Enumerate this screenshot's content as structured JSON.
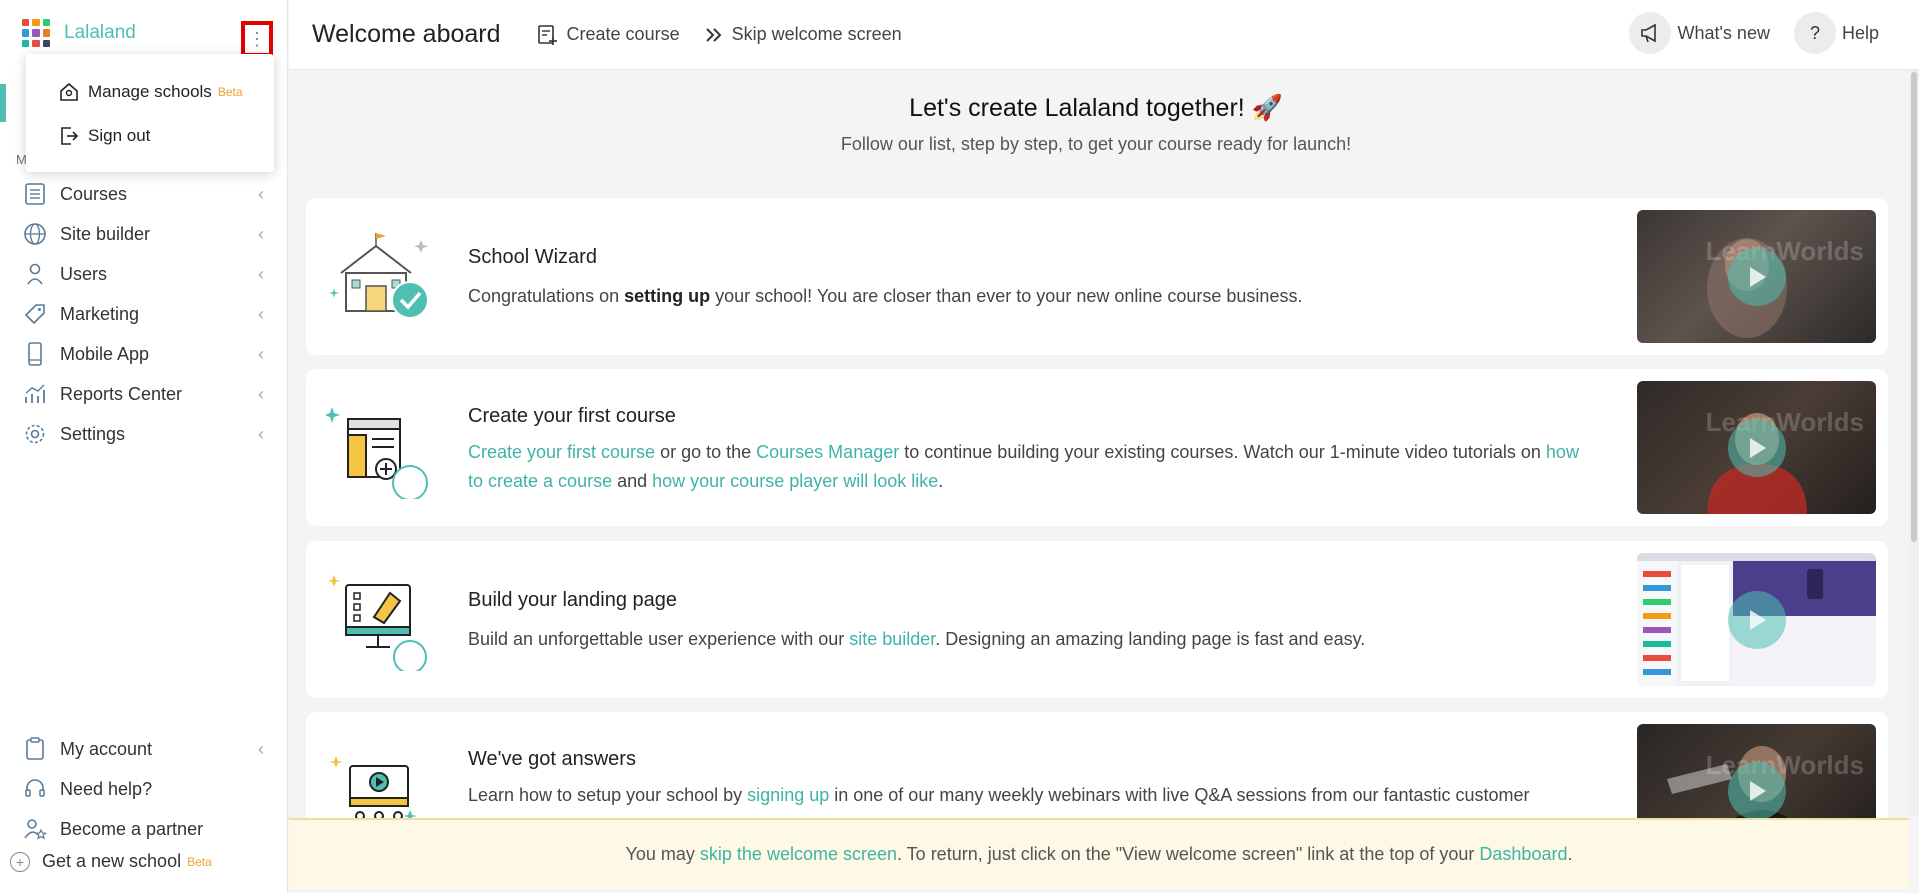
{
  "sidebar": {
    "brand_name": "Lalaland",
    "kebab_glyph": "⋮",
    "section_letter": "M",
    "items": [
      {
        "label": "Courses",
        "icon": "courses-icon"
      },
      {
        "label": "Site builder",
        "icon": "globe-icon"
      },
      {
        "label": "Users",
        "icon": "user-icon"
      },
      {
        "label": "Marketing",
        "icon": "tag-icon"
      },
      {
        "label": "Mobile App",
        "icon": "mobile-icon"
      },
      {
        "label": "Reports Center",
        "icon": "chart-icon"
      },
      {
        "label": "Settings",
        "icon": "gear-icon"
      }
    ],
    "bottom_items": [
      {
        "label": "My account",
        "icon": "clipboard-icon"
      },
      {
        "label": "Need help?",
        "icon": "headset-icon"
      },
      {
        "label": "Become a partner",
        "icon": "partner-icon"
      }
    ],
    "new_school_label": "Get a new school",
    "new_school_badge": "Beta"
  },
  "dropdown": {
    "manage_label": "Manage schools",
    "manage_badge": "Beta",
    "signout_label": "Sign out"
  },
  "topbar": {
    "title": "Welcome aboard",
    "create_course": "Create course",
    "skip_welcome": "Skip welcome screen",
    "whats_new": "What's new",
    "help": "Help"
  },
  "hero": {
    "title": "Let's create Lalaland together! 🚀",
    "subtitle": "Follow our list, step by step, to get your course ready for launch!"
  },
  "cards": [
    {
      "title": "School Wizard",
      "body_pre": "Congratulations on ",
      "body_bold": "setting up",
      "body_post": " your school! You are closer than ever to your new online course business."
    },
    {
      "title": "Create your first course",
      "link1": "Create your first course",
      "text1": " or go to the ",
      "link2": "Courses Manager",
      "text2": " to continue building your existing courses. Watch our 1-minute video tutorials on ",
      "link3": "how to create a course",
      "text3": " and ",
      "link4": "how your course player will look like",
      "text4": "."
    },
    {
      "title": "Build your landing page",
      "text1": "Build an unforgettable user experience with our ",
      "link1": "site builder",
      "text2": ". Designing an amazing landing page is fast and easy."
    },
    {
      "title": "We've got answers",
      "text1": "Learn how to setup your school by ",
      "link1": "signing up",
      "text2": " in one of our many weekly webinars with live Q&A sessions from our fantastic customer"
    }
  ],
  "video_watermark": "LearnWorlds",
  "banner": {
    "text1": "You may ",
    "link1": "skip the welcome screen",
    "text2": ". To return, just click on the \"View welcome screen\" link at the top of your ",
    "link2": "Dashboard",
    "text3": "."
  },
  "colors": {
    "accent": "#4fbfb3",
    "beta": "#f0a030",
    "banner_bg": "#fdf9e6",
    "highlight_box": "#e00000"
  }
}
